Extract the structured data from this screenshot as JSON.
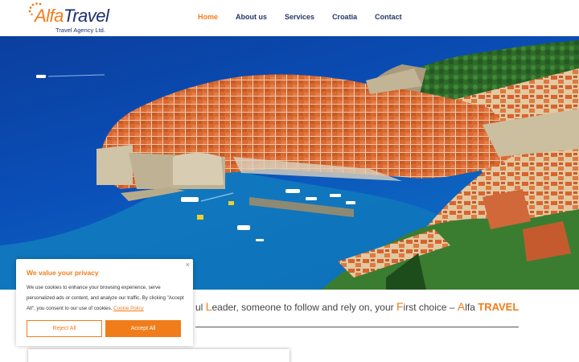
{
  "logo": {
    "alfa": "Alfa",
    "travel": "Travel",
    "subtitle": "Travel Agency Ltd.",
    "icon": "sun-icon"
  },
  "nav": {
    "items": [
      {
        "label": "Home",
        "active": true
      },
      {
        "label": "About us",
        "active": false
      },
      {
        "label": "Services",
        "active": false
      },
      {
        "label": "Croatia",
        "active": false
      },
      {
        "label": "Contact",
        "active": false
      }
    ]
  },
  "hero": {
    "icon": "dubrovnik-hero-image"
  },
  "tagline": {
    "part1": "ul ",
    "hl1": "L",
    "part2": "eader, someone to follow and rely on, your ",
    "hl2": "F",
    "part3": "irst choice – ",
    "hl3": "A",
    "part4": "lfa ",
    "brand": "TRAVEL"
  },
  "cookie": {
    "title": "We value your privacy",
    "text": "We use cookies to enhance your browsing experience, serve personalized ads or content, and analyze our traffic. By clicking \"Accept All\", you consent to our use of cookies. ",
    "link": "Cookie Policy",
    "reject": "Reject All",
    "accept": "Accept All",
    "close": "×"
  },
  "colors": {
    "accent": "#f07d1a",
    "navy": "#1d2f6f"
  }
}
